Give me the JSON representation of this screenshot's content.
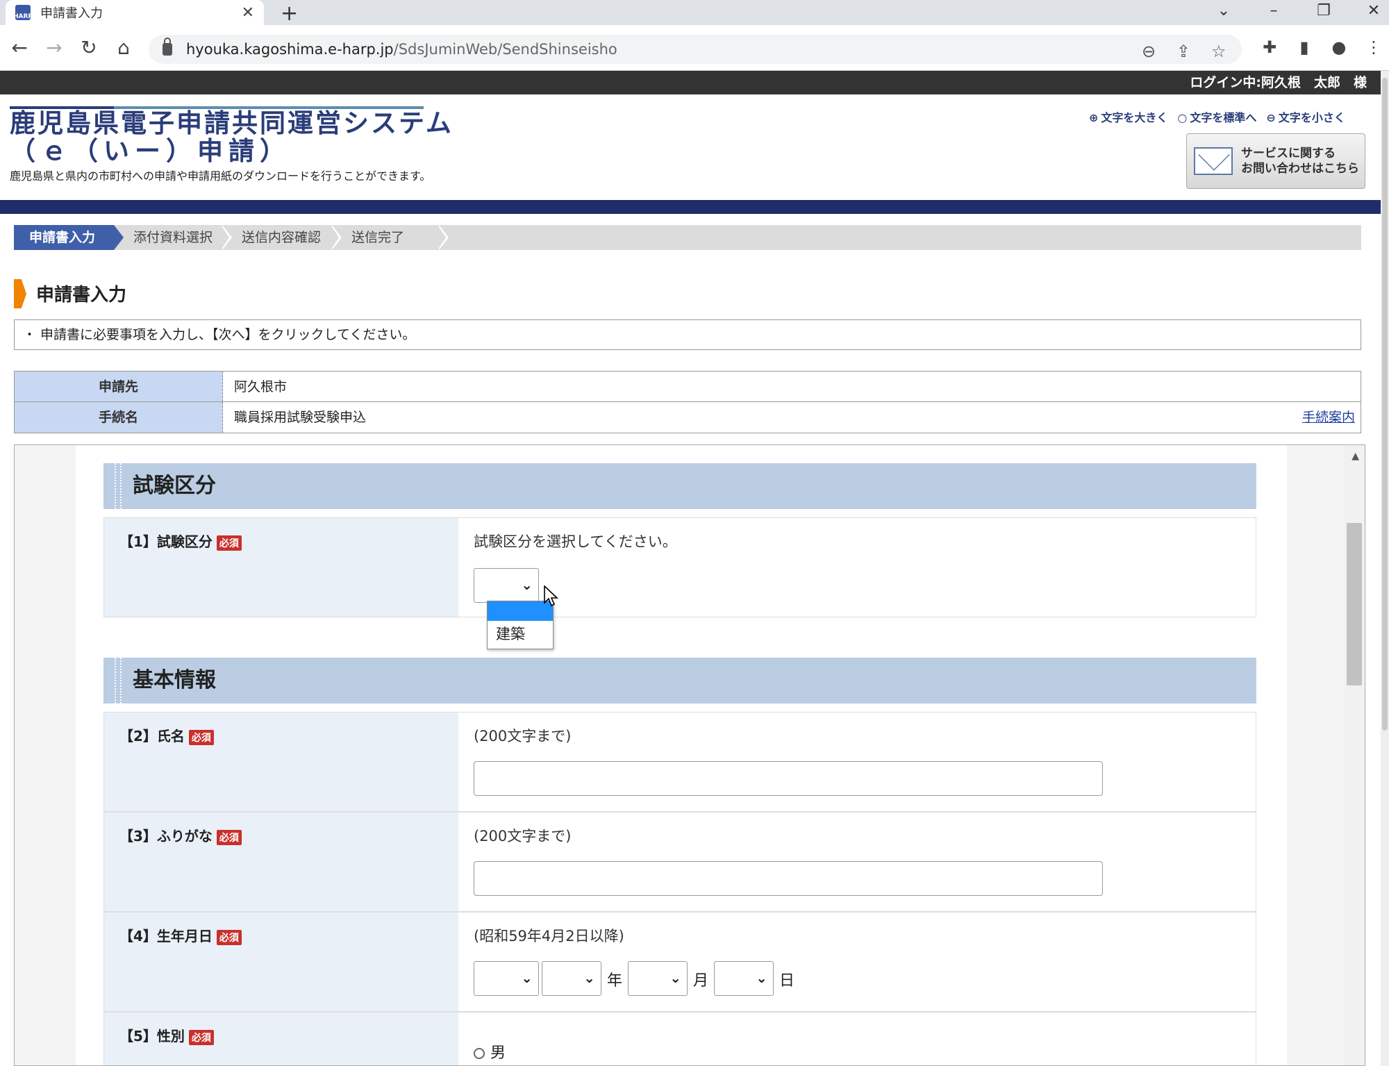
{
  "browser": {
    "tab_title": "申請書入力",
    "favicon_label": "HARP",
    "url_host": "hyouka.kagoshima.e-harp.jp",
    "url_path": "/SdsJuminWeb/SendShinseisho"
  },
  "page": {
    "login_status": "ログイン中:阿久根　太郎　様",
    "site_title": "鹿児島県電子申請共同運営システム",
    "site_title_sub": "（ｅ（いー）申請）",
    "site_description": "鹿児島県と県内の市町村への申請や申請用紙のダウンロードを行うことができます。",
    "font_links": [
      "文字を大きく",
      "文字を標準へ",
      "文字を小さく"
    ],
    "contact_button": [
      "サービスに関する",
      "お問い合わせはこちら"
    ]
  },
  "steps": [
    "申請書入力",
    "添付資料選択",
    "送信内容確認",
    "送信完了"
  ],
  "section": {
    "title": "申請書入力",
    "instruction": "・ 申請書に必要事項を入力し、【次へ】をクリックしてください。"
  },
  "summary": {
    "destination_label": "申請先",
    "destination_value": "阿久根市",
    "procedure_label": "手続名",
    "procedure_value": "職員採用試験受験申込",
    "procedure_link": "手続案内"
  },
  "form": {
    "required_badge": "必須",
    "group_exam": "試験区分",
    "q1_label": "【1】試験区分",
    "q1_hint": "試験区分を選択してください。",
    "q1_options": [
      "",
      "建築"
    ],
    "group_basic": "基本情報",
    "q2_label": "【2】氏名",
    "q2_hint": "(200文字まで)",
    "q3_label": "【3】ふりがな",
    "q3_hint": "(200文字まで)",
    "q4_label": "【4】生年月日",
    "q4_hint": "(昭和59年4月2日以降)",
    "q4_units": [
      "年",
      "月",
      "日"
    ],
    "q5_label": "【5】性別",
    "q5_option_male": "男"
  }
}
